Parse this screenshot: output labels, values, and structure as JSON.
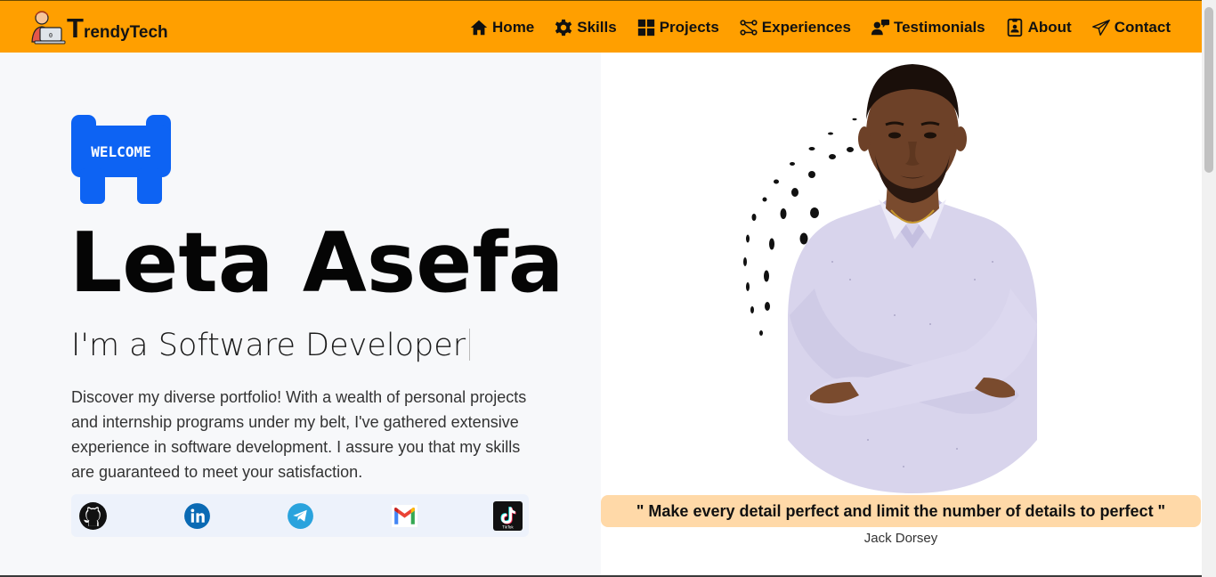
{
  "brand": {
    "initial": "T",
    "rest": "rendyTech"
  },
  "nav": [
    {
      "label": "Home",
      "icon": "home-icon"
    },
    {
      "label": "Skills",
      "icon": "gear-icon"
    },
    {
      "label": "Projects",
      "icon": "grid-icon"
    },
    {
      "label": "Experiences",
      "icon": "flow-icon"
    },
    {
      "label": "Testimonials",
      "icon": "user-comment-icon"
    },
    {
      "label": "About",
      "icon": "id-card-icon"
    },
    {
      "label": "Contact",
      "icon": "paper-plane-icon"
    }
  ],
  "hero": {
    "welcome_sign": "WELCOME",
    "name": "Leta Asefa",
    "role": "I'm a Software Developer",
    "description": "Discover my diverse portfolio! With a wealth of personal projects and internship programs under my belt, I've gathered extensive experience in software development. I assure you that my skills are guaranteed to meet your satisfaction.",
    "socials": [
      {
        "name": "GitHub",
        "icon": "github-icon"
      },
      {
        "name": "LinkedIn",
        "icon": "linkedin-icon"
      },
      {
        "name": "Telegram",
        "icon": "telegram-icon"
      },
      {
        "name": "Gmail",
        "icon": "gmail-icon"
      },
      {
        "name": "TikTok",
        "icon": "tiktok-icon"
      }
    ],
    "tiktok_small_label": "TikTok"
  },
  "quote": {
    "text": "\" Make every detail perfect and limit the number of details to perfect \"",
    "author": "Jack Dorsey"
  },
  "colors": {
    "navbar": "#ff9f00",
    "welcome_blue": "#0d63f3",
    "quote_bg": "#ffd9a8"
  }
}
